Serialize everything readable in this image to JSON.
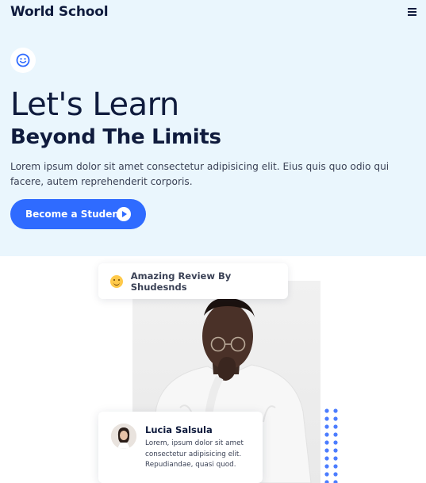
{
  "header": {
    "brand": "World School",
    "menu_icon": "hamburger-menu-icon"
  },
  "hero": {
    "badge_icon": "smile-icon",
    "headline": "Let's Learn",
    "subheadline": "Beyond The Limits",
    "lede": "Lorem ipsum dolor sit amet consectetur adipisicing elit. Eius quis quo odio qui facere, autem reprehenderit corporis.",
    "cta_label": "Become a Student",
    "cta_icon": "play-icon"
  },
  "review_badge": {
    "icon": "smiling-emoji-icon",
    "label": "Amazing Review By Shudesnds"
  },
  "testimonial": {
    "name": "Lucia Salsula",
    "quote": "Lorem, ipsum dolor sit amet consectetur adipisicing elit. Repudiandae, quasi quod."
  },
  "colors": {
    "hero_bg": "#eaf6fd",
    "primary": "#2f6bff",
    "text_dark": "#0f1b3d",
    "dot_accent": "#4c7dff"
  }
}
